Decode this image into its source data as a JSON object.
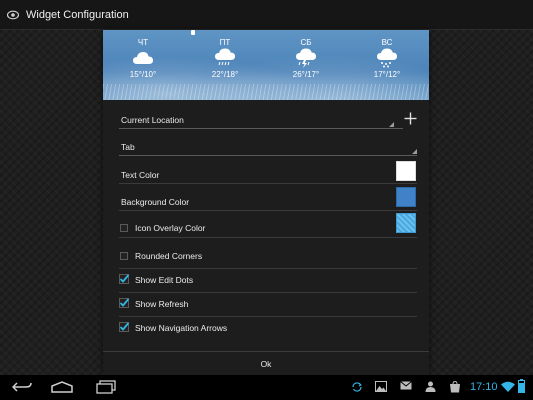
{
  "titlebar": {
    "title": "Widget Configuration",
    "icon": "eye-icon"
  },
  "preview": {
    "days": [
      {
        "name": "ЧТ",
        "temp": "15°/10°",
        "icon": "cloud-icon"
      },
      {
        "name": "ПТ",
        "temp": "22°/18°",
        "icon": "cloud-rain-icon"
      },
      {
        "name": "СБ",
        "temp": "26°/17°",
        "icon": "thunderstorm-icon"
      },
      {
        "name": "ВС",
        "temp": "17°/12°",
        "icon": "cloud-snow-icon"
      }
    ]
  },
  "settings": {
    "location": "Current Location",
    "tab": "Tab",
    "text_color_label": "Text Color",
    "text_color": "#ffffff",
    "background_color_label": "Background Color",
    "background_color": "#3f82c8",
    "icon_overlay_label": "Icon Overlay Color",
    "icon_overlay_color": "#62b9e8",
    "rounded_corners_label": "Rounded Corners",
    "show_edit_dots_label": "Show Edit Dots",
    "show_refresh_label": "Show Refresh",
    "show_nav_arrows_label": "Show Navigation Arrows"
  },
  "checkboxes": {
    "icon_overlay": false,
    "rounded_corners": false,
    "show_edit_dots": true,
    "show_refresh": true,
    "show_nav_arrows": true
  },
  "ok_label": "Ok",
  "statusbar": {
    "time": "17:10",
    "accent": "#33b5e5"
  }
}
